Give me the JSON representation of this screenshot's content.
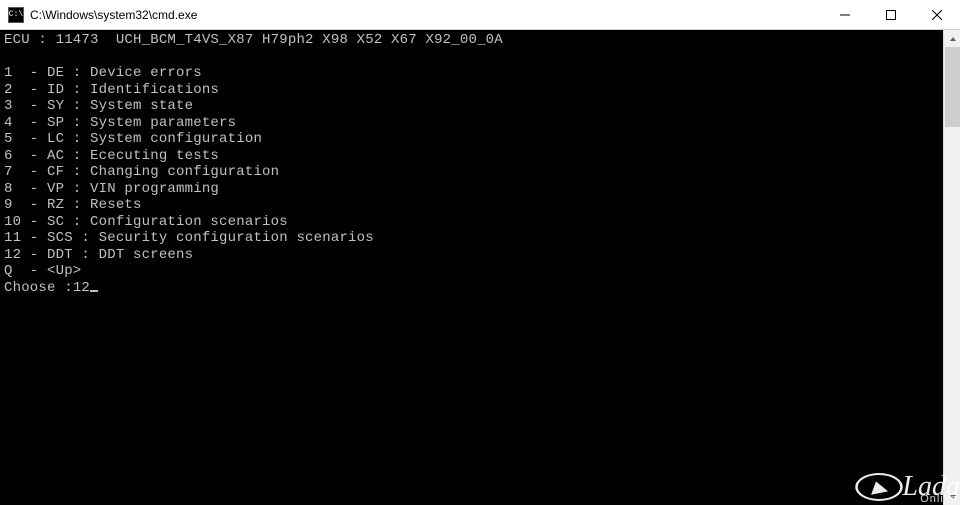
{
  "titlebar": {
    "icon_text": "C:\\",
    "title": "C:\\Windows\\system32\\cmd.exe"
  },
  "terminal": {
    "header": "ECU : 11473  UCH_BCM_T4VS_X87 H79ph2 X98 X52 X67 X92_00_0A",
    "menu": [
      "1  - DE : Device errors",
      "2  - ID : Identifications",
      "3  - SY : System state",
      "4  - SP : System parameters",
      "5  - LC : System configuration",
      "6  - AC : Ececuting tests",
      "7  - CF : Changing configuration",
      "8  - VP : VIN programming",
      "9  - RZ : Resets",
      "10 - SC : Configuration scenarios",
      "11 - SCS : Security configuration scenarios",
      "12 - DDT : DDT screens",
      "Q  - <Up>"
    ],
    "prompt_label": "Choose :",
    "prompt_value": "12"
  },
  "watermark": {
    "brand": "Lada",
    "sub": "Online"
  }
}
